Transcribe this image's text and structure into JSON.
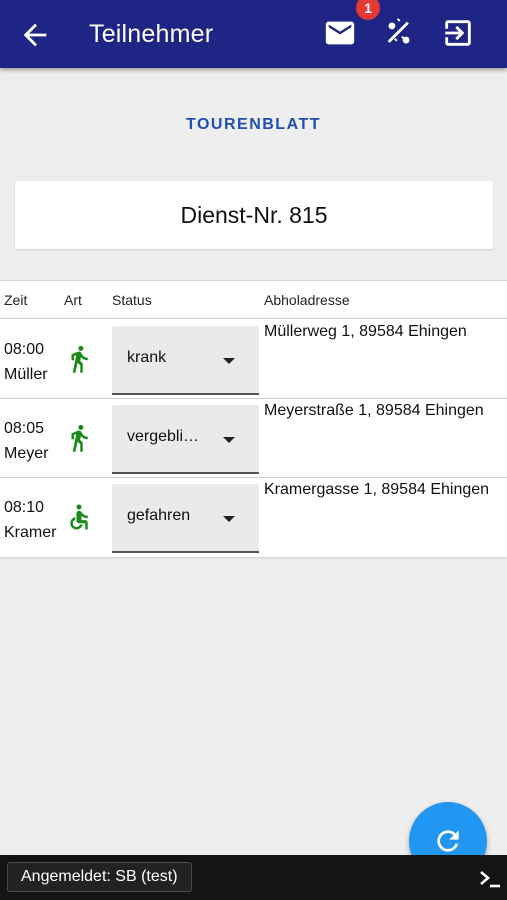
{
  "header": {
    "title": "Teilnehmer",
    "back_icon": "arrow-back-icon",
    "mail_icon": "mail-icon",
    "mail_badge": "1",
    "tour_icon": "percent-icon",
    "logout_icon": "logout-icon",
    "background": "#1f2585"
  },
  "section_title": "TOURENBLATT",
  "dienst": {
    "label": "Dienst-Nr. 815"
  },
  "table": {
    "columns": [
      "Zeit",
      "Art",
      "Status",
      "Abholadresse"
    ],
    "rows": [
      {
        "time": "08:00",
        "name": "Müller",
        "art_icon": "walking-person-icon",
        "status": "krank",
        "address": "Müllerweg 1, 89584 Ehingen"
      },
      {
        "time": "08:05",
        "name": "Meyer",
        "art_icon": "walking-person-icon",
        "status": "vergebli…",
        "address": "Meyerstraße 1, 89584 Ehingen"
      },
      {
        "time": "08:10",
        "name": "Kramer",
        "art_icon": "wheelchair-icon",
        "status": "gefahren",
        "address": "Kramergasse 1, 89584 Ehingen"
      }
    ]
  },
  "fab": {
    "icon": "refresh-icon",
    "color": "#2196f3"
  },
  "footer": {
    "logged_in": "Angemeldet: SB (test)",
    "terminal_icon": "terminal-icon"
  },
  "colors": {
    "accent": "#1e4fb3",
    "art_icon": "#1b8a1b",
    "badge": "#e53935"
  }
}
